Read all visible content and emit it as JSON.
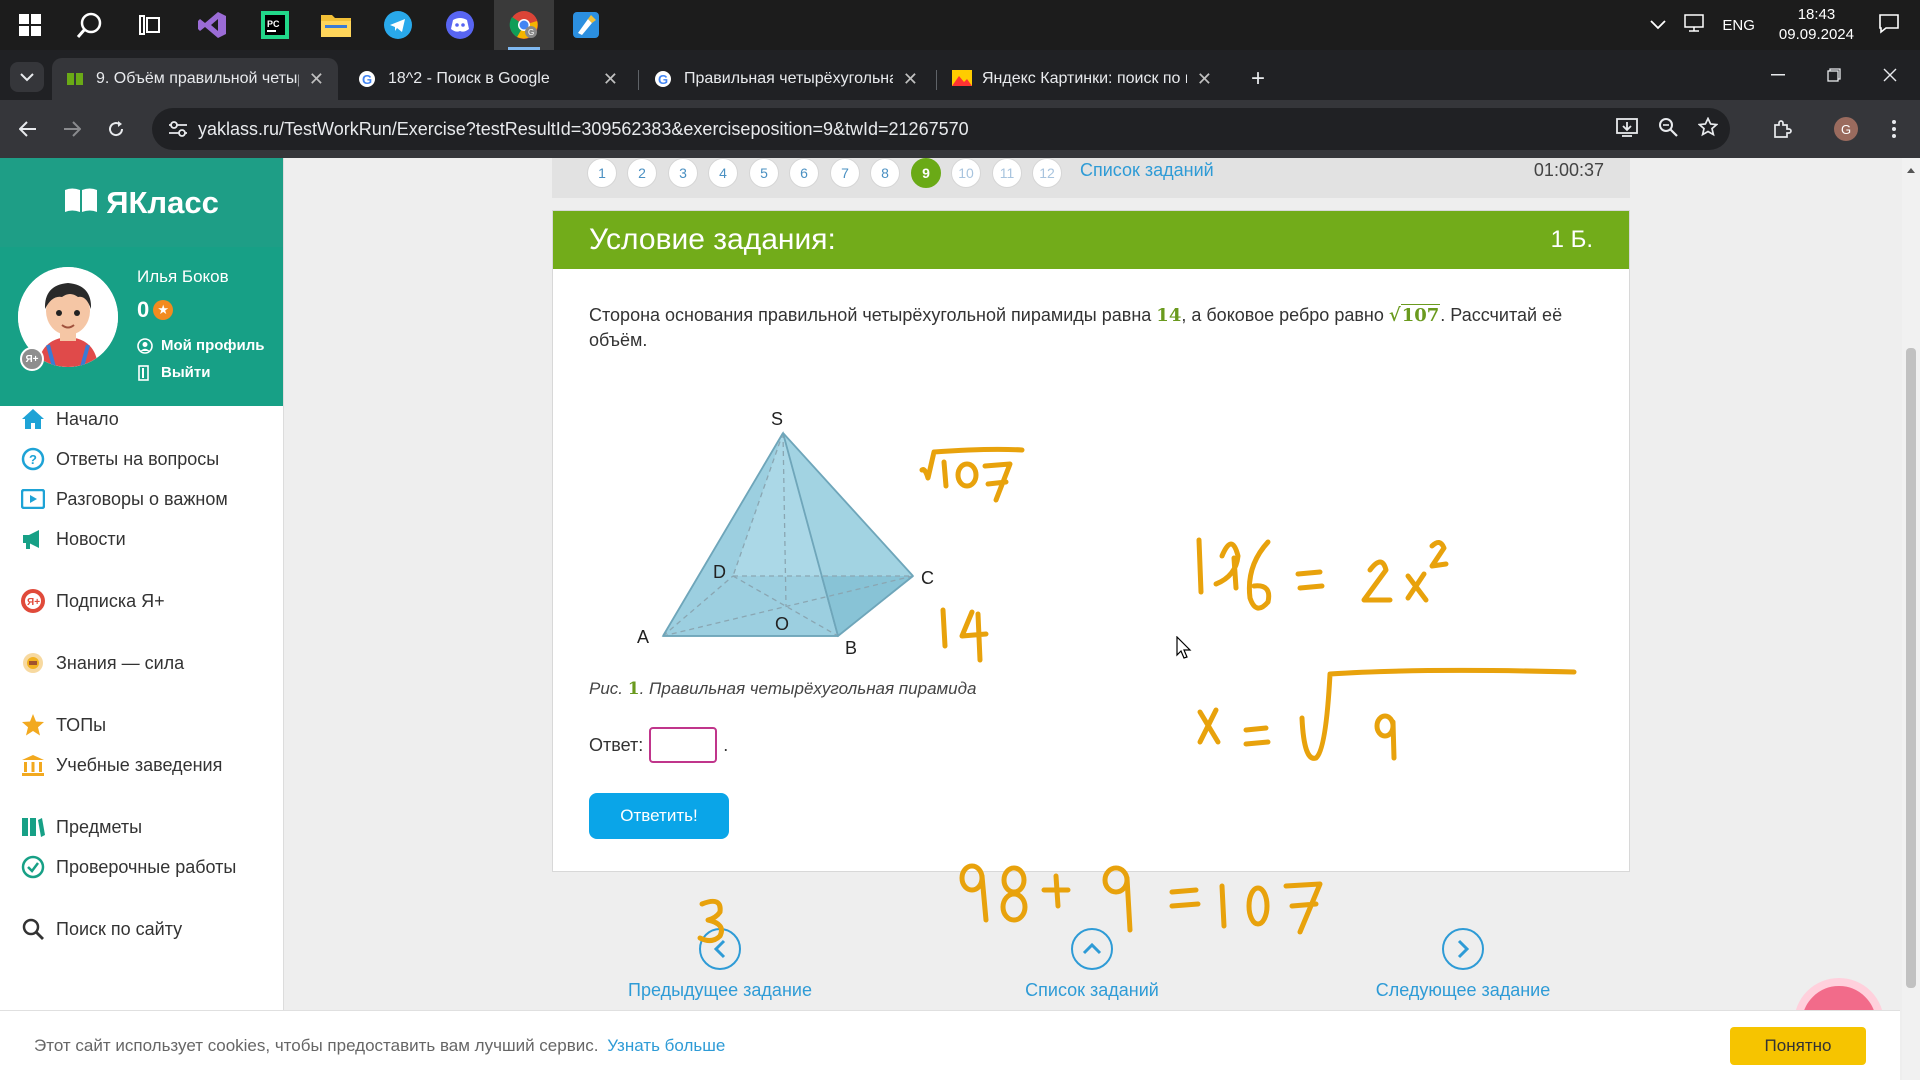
{
  "taskbar": {
    "apps": [
      "start-icon",
      "search-icon",
      "task-view-icon",
      "visual-studio-icon",
      "pycharm-icon",
      "file-explorer-icon",
      "telegram-icon",
      "discord-icon",
      "chrome-icon",
      "paint-icon"
    ],
    "lang": "ENG",
    "time": "18:43",
    "date": "09.09.2024"
  },
  "browser": {
    "tabs": [
      {
        "title": "9. Объём правильной четырё",
        "active": true
      },
      {
        "title": "18^2 - Поиск в Google",
        "active": false
      },
      {
        "title": "Правильная четырёхугольная",
        "active": false
      },
      {
        "title": "Яндекс Картинки: поиск по из",
        "active": false
      }
    ],
    "url": "yaklass.ru/TestWorkRun/Exercise?testResultId=309562383&exerciseposition=9&twId=21267570",
    "profile_initial": "G"
  },
  "sidebar": {
    "logo": "ЯКласс",
    "user_name": "Илья Боков",
    "score": "0",
    "ya_badge": "Я+",
    "profile_link": "Мой профиль",
    "logout_link": "Выйти",
    "menu": [
      {
        "label": "Начало",
        "icon": "home-icon",
        "color": "#1ea3d6"
      },
      {
        "label": "Ответы на вопросы",
        "icon": "question-icon",
        "color": "#1ea3d6"
      },
      {
        "label": "Разговоры о важном",
        "icon": "play-icon",
        "color": "#1ea3d6"
      },
      {
        "label": "Новости",
        "icon": "megaphone-icon",
        "color": "#17a086"
      },
      {
        "label": "Подписка Я+",
        "icon": "subscription-icon",
        "color": "#e04a3a"
      },
      {
        "label": "Знания — сила",
        "icon": "knowledge-icon",
        "color": "#f2b21f"
      },
      {
        "label": "ТОПы",
        "icon": "star-icon",
        "color": "#f2a91f"
      },
      {
        "label": "Учебные заведения",
        "icon": "school-icon",
        "color": "#f2a91f"
      },
      {
        "label": "Предметы",
        "icon": "books-icon",
        "color": "#17a086"
      },
      {
        "label": "Проверочные работы",
        "icon": "check-icon",
        "color": "#17a086"
      },
      {
        "label": "Поиск по сайту",
        "icon": "search-icon",
        "color": "#333333"
      }
    ]
  },
  "pager": {
    "pages": [
      "1",
      "2",
      "3",
      "4",
      "5",
      "6",
      "7",
      "8",
      "9",
      "10",
      "11",
      "12"
    ],
    "current": "9",
    "list_label": "Список заданий",
    "timer": "01:00:37"
  },
  "task": {
    "header": "Условие задания:",
    "points": "1 Б.",
    "text_part1": "Сторона основания правильной четырёхугольной пирамиды равна",
    "side": "14",
    "text_part2": ", а боковое ребро равно",
    "edge": "107",
    "text_part3": ". Рассчитай её объём.",
    "figure_labels": {
      "s": "S",
      "a": "A",
      "b": "B",
      "c": "C",
      "d": "D",
      "o": "O"
    },
    "caption_prefix": "Рис.",
    "caption_num": "1",
    "caption_text": ". Правильная четырёхугольная пирамида",
    "answer_label": "Ответ:",
    "answer_suffix": ".",
    "answer_value": "",
    "submit": "Ответить!"
  },
  "handwriting": {
    "sqrt107": "√107",
    "fourteen": "14",
    "eq1": "196 = 2x²",
    "eq2": "x = √9",
    "eq3": "98 + 9 = 107",
    "three": "3",
    "color": "#e8a20c"
  },
  "bottom_nav": {
    "prev": "Предыдущее задание",
    "list": "Список заданий",
    "next": "Следующее задание"
  },
  "cookie": {
    "text": "Этот сайт использует cookies, чтобы предоставить вам лучший сервис.",
    "link": "Узнать больше",
    "button": "Понятно"
  }
}
